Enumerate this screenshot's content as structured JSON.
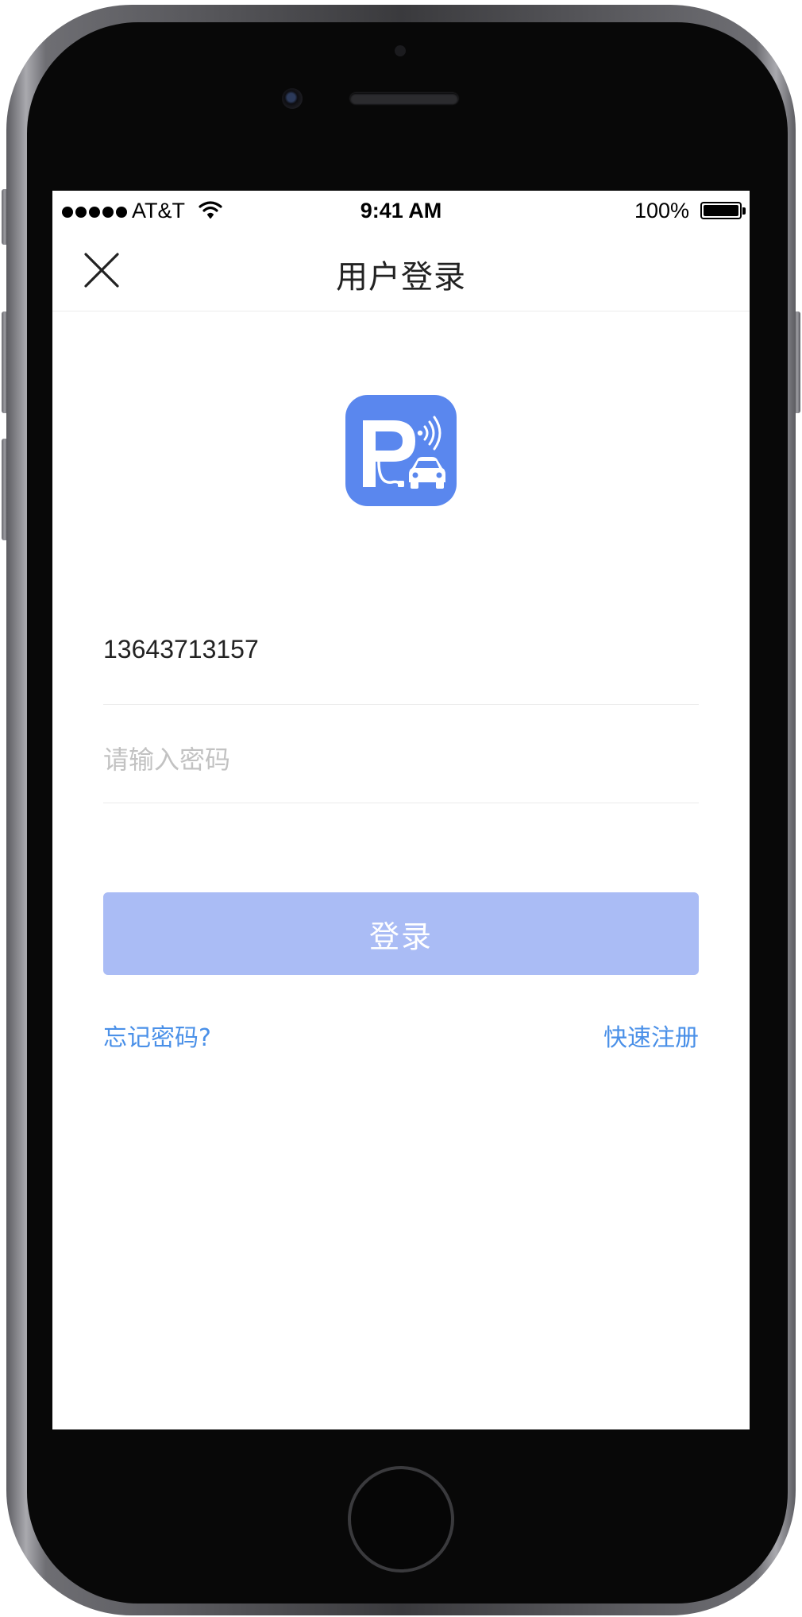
{
  "status_bar": {
    "carrier": "AT&T",
    "time": "9:41 AM",
    "battery": "100%",
    "icons": [
      "signal-dots-icon",
      "wifi-icon",
      "battery-icon"
    ]
  },
  "nav": {
    "title": "用户登录",
    "close_icon": "close-icon"
  },
  "logo": {
    "icon": "parking-ev-logo",
    "letter": "P",
    "background": "#5a87ee"
  },
  "form": {
    "phone_value": "13643713157",
    "password_placeholder": "请输入密码",
    "login_label": "登录"
  },
  "links": {
    "forgot_password": "忘记密码?",
    "register": "快速注册"
  },
  "colors": {
    "accent_link": "#4a90e8",
    "button_disabled": "#aabcf5",
    "logo_blue": "#5a87ee"
  }
}
